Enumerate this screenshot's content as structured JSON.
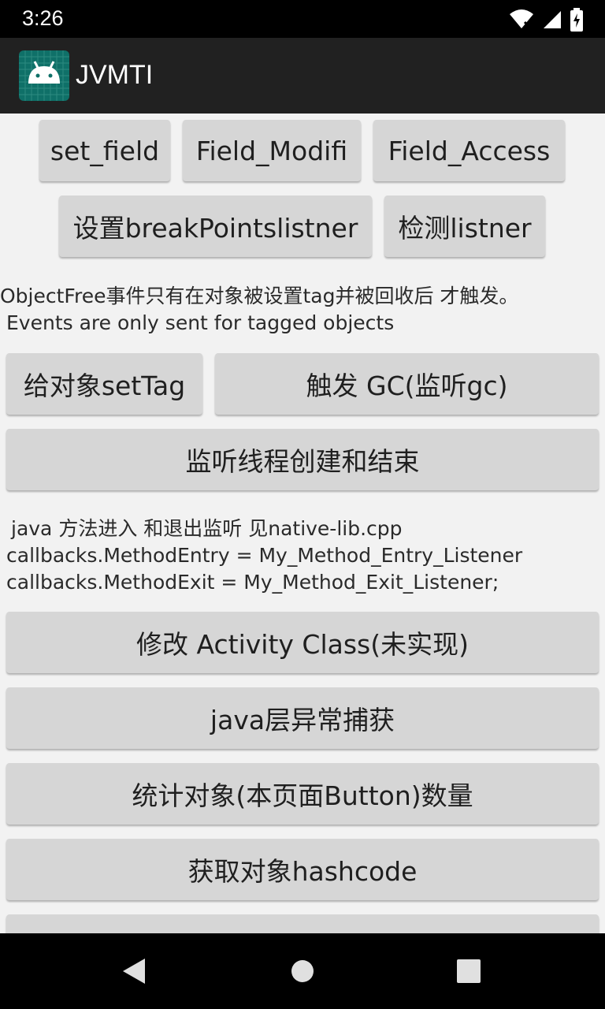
{
  "status_bar": {
    "time": "3:26"
  },
  "app_bar": {
    "title": "JVMTI"
  },
  "buttons": {
    "set_field": "set_field",
    "field_modifi": "Field_Modifi",
    "field_access": "Field_Access",
    "set_breakpoints_listener": "设置breakPointslistner",
    "detect_listener": "检测listner",
    "set_tag": "给对象setTag",
    "trigger_gc": "触发 GC(监听gc)",
    "monitor_thread": "监听线程创建和结束",
    "modify_activity_class": "修改 Activity Class(未实现)",
    "java_exception_capture": "java层异常捕获",
    "count_objects": "统计对象(本页面Button)数量",
    "get_hashcode": "获取对象hashcode",
    "partial_next": "..."
  },
  "notes": {
    "objectfree_line1": "ObjectFree事件只有在对象被设置tag并被回收后 才触发。",
    "objectfree_line2": "Events are only sent for tagged objects",
    "method_line1": "java 方法进入 和退出监听 见native-lib.cpp",
    "method_line2": "callbacks.MethodEntry = My_Method_Entry_Listener",
    "method_line3": "callbacks.MethodExit = My_Method_Exit_Listener;"
  },
  "icons": {
    "wifi": "wifi-icon",
    "signal": "signal-icon",
    "battery": "battery-icon",
    "app": "android-app-icon",
    "back": "back-icon",
    "home": "home-icon",
    "recents": "recents-icon"
  }
}
